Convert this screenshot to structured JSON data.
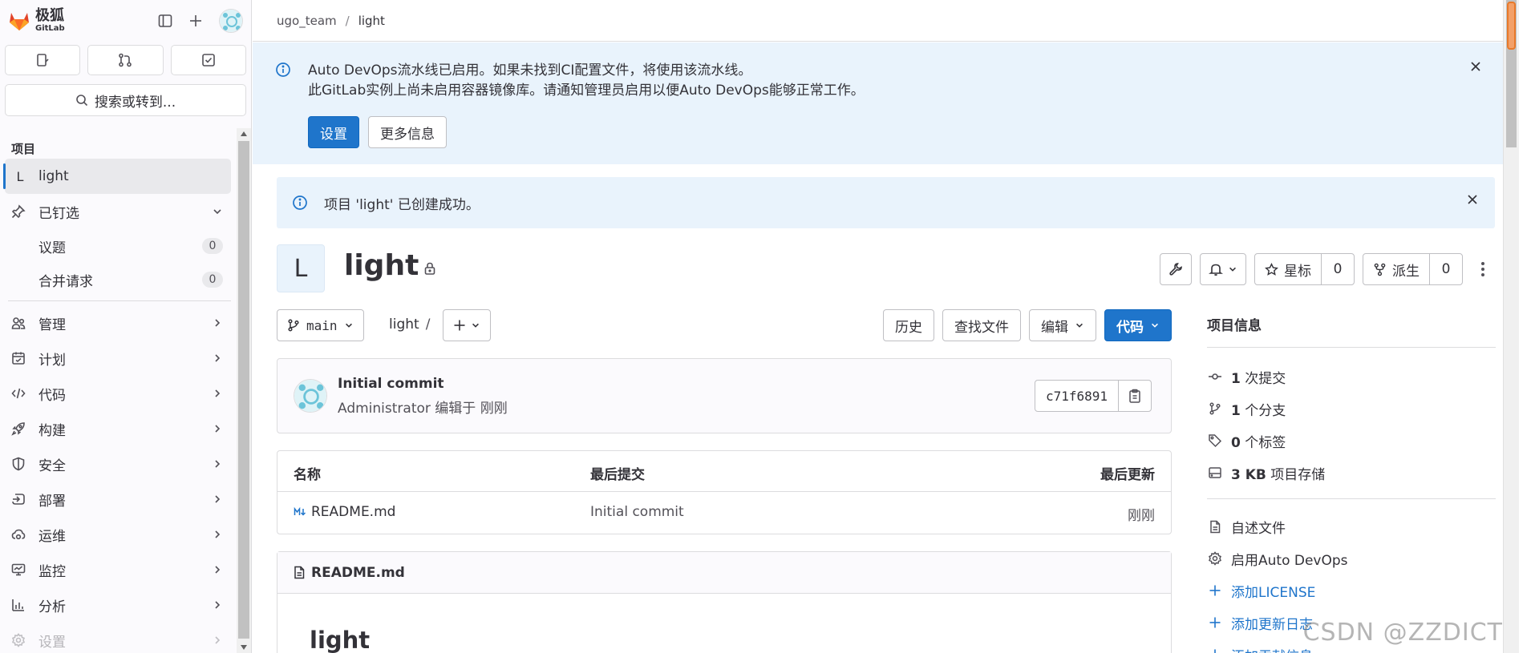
{
  "app": {
    "brand_cn": "极狐",
    "brand_en": "GitLab"
  },
  "sidebar": {
    "search_label": "搜索或转到...",
    "section_label": "项目",
    "project": {
      "letter": "L",
      "name": "light"
    },
    "pinned": {
      "label": "已钉选",
      "items": [
        {
          "label": "议题",
          "count": "0"
        },
        {
          "label": "合并请求",
          "count": "0"
        }
      ]
    },
    "nav": [
      {
        "label": "管理",
        "icon": "users-icon"
      },
      {
        "label": "计划",
        "icon": "planning-icon"
      },
      {
        "label": "代码",
        "icon": "code-icon"
      },
      {
        "label": "构建",
        "icon": "rocket-icon"
      },
      {
        "label": "安全",
        "icon": "shield-icon"
      },
      {
        "label": "部署",
        "icon": "deploy-icon"
      },
      {
        "label": "运维",
        "icon": "cloud-gear-icon"
      },
      {
        "label": "监控",
        "icon": "monitor-icon"
      },
      {
        "label": "分析",
        "icon": "chart-icon"
      },
      {
        "label": "设置",
        "icon": "settings-icon"
      }
    ]
  },
  "breadcrumb": {
    "group": "ugo_team",
    "sep": "/",
    "project": "light"
  },
  "devops_banner": {
    "line1": "Auto DevOps流水线已启用。如果未找到CI配置文件，将使用该流水线。",
    "line2": "此GitLab实例上尚未启用容器镜像库。请通知管理员启用以便Auto DevOps能够正常工作。",
    "primary_btn": "设置",
    "secondary_btn": "更多信息"
  },
  "success_banner": {
    "text": "项目 'light' 已创建成功。"
  },
  "project": {
    "avatar_letter": "L",
    "name": "light",
    "star_label": "星标",
    "star_count": "0",
    "fork_label": "派生",
    "fork_count": "0"
  },
  "repo": {
    "branch": "main",
    "path": "light",
    "path_sep": "/",
    "history_btn": "历史",
    "find_file_btn": "查找文件",
    "edit_btn": "编辑",
    "code_btn": "代码"
  },
  "last_commit": {
    "title": "Initial commit",
    "author": "Administrator",
    "meta_suffix": "编辑于 刚刚",
    "sha": "c71f6891"
  },
  "files_table": {
    "headers": {
      "name": "名称",
      "last_commit": "最后提交",
      "last_update": "最后更新"
    },
    "rows": [
      {
        "name": "README.md",
        "last_commit": "Initial commit",
        "last_update": "刚刚"
      }
    ]
  },
  "readme": {
    "header": "README.md",
    "title": "light"
  },
  "project_info": {
    "title": "项目信息",
    "stats": [
      {
        "icon": "commit-icon",
        "value": "1",
        "label": "次提交"
      },
      {
        "icon": "branch-icon",
        "value": "1",
        "label": "个分支"
      },
      {
        "icon": "tag-icon",
        "value": "0",
        "label": "个标签"
      },
      {
        "icon": "storage-icon",
        "value": "3 KB",
        "label": "项目存储"
      }
    ],
    "links": [
      {
        "icon": "file-icon",
        "label": "自述文件"
      },
      {
        "icon": "settings-icon",
        "label": "启用Auto DevOps"
      },
      {
        "icon": "plus-icon",
        "label": "添加LICENSE"
      },
      {
        "icon": "plus-icon",
        "label": "添加更新日志"
      },
      {
        "icon": "plus-icon",
        "label": "添加贡献信息"
      }
    ]
  },
  "watermark": "CSDN @ZZDICT",
  "colors": {
    "accent": "#1f75cb",
    "banner_bg": "#e9f3fc",
    "brand_orange": "#e24329"
  }
}
